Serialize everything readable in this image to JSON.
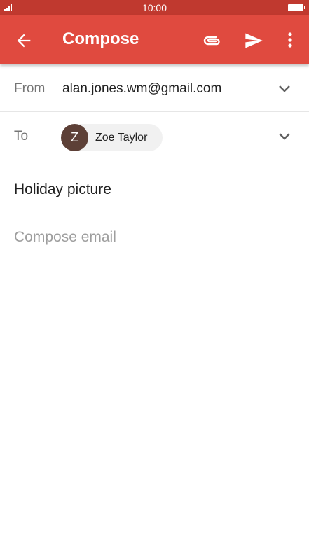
{
  "status_bar": {
    "time": "10:00"
  },
  "app_bar": {
    "title": "Compose",
    "back_icon": "arrow-back-icon",
    "attach_icon": "paperclip-icon",
    "send_icon": "send-icon",
    "more_icon": "more-vert-icon",
    "color": "#e04a3f"
  },
  "from": {
    "label": "From",
    "value": "alan.jones.wm@gmail.com"
  },
  "to": {
    "label": "To",
    "recipients": [
      {
        "initial": "Z",
        "name": "Zoe Taylor",
        "avatar_color": "#5d4037"
      }
    ]
  },
  "subject": {
    "value": "Holiday picture"
  },
  "body": {
    "placeholder": "Compose email"
  }
}
